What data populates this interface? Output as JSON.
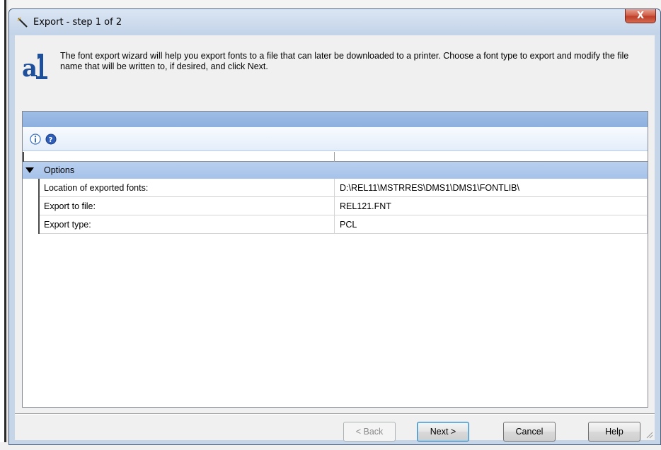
{
  "window": {
    "title": "Export - step 1 of 2",
    "close_label": "X"
  },
  "intro": {
    "text": "The font export wizard will help you export fonts to a file that can later be downloaded to a printer. Choose a font type to export and modify the file name that will be written to, if desired, and click Next."
  },
  "toolbar": {
    "icons": [
      "info-icon",
      "help-icon"
    ]
  },
  "grid": {
    "category": "Options",
    "rows": [
      {
        "name": "Location of exported fonts:",
        "value": "D:\\REL11\\MSTRRES\\DMS1\\DMS1\\FONTLIB\\"
      },
      {
        "name": "Export to file:",
        "value": "REL121.FNT"
      },
      {
        "name": "Export type:",
        "value": "PCL"
      }
    ]
  },
  "buttons": {
    "back": "< Back",
    "next": "Next >",
    "cancel": "Cancel",
    "help": "Help"
  },
  "colors": {
    "header_blue": "#8db0df",
    "category_blue": "#a6c2ea",
    "close_red": "#c0402a"
  }
}
